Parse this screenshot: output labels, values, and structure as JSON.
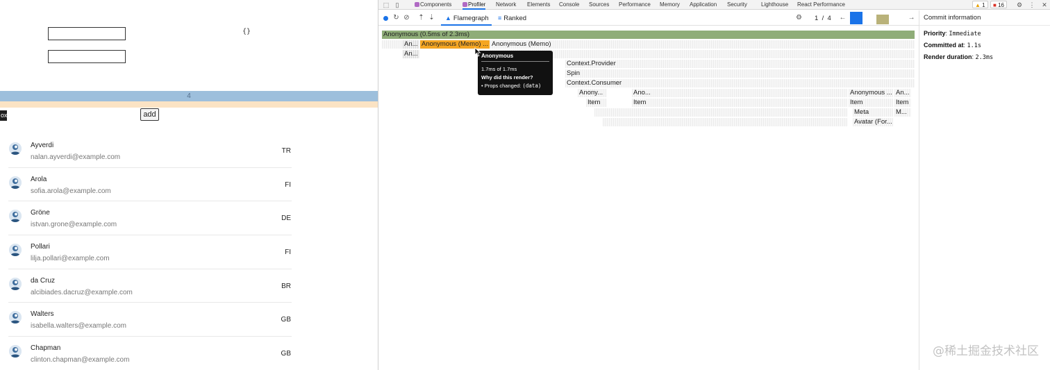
{
  "app": {
    "braces": "{}",
    "count": "4",
    "black_tag": "ox",
    "add_label": "add",
    "users": [
      {
        "name": "Ayverdi",
        "email": "nalan.ayverdi@example.com",
        "country": "TR"
      },
      {
        "name": "Arola",
        "email": "sofia.arola@example.com",
        "country": "FI"
      },
      {
        "name": "Gröne",
        "email": "istvan.grone@example.com",
        "country": "DE"
      },
      {
        "name": "Pollari",
        "email": "lilja.pollari@example.com",
        "country": "FI"
      },
      {
        "name": "da Cruz",
        "email": "alcibiades.dacruz@example.com",
        "country": "BR"
      },
      {
        "name": "Walters",
        "email": "isabella.walters@example.com",
        "country": "GB"
      },
      {
        "name": "Chapman",
        "email": "clinton.chapman@example.com",
        "country": "GB"
      }
    ]
  },
  "devtools": {
    "tabs": [
      "Components",
      "Profiler",
      "Network",
      "Elements",
      "Console",
      "Sources",
      "Performance",
      "Memory",
      "Application",
      "Security",
      "Lighthouse",
      "React Performance"
    ],
    "active_tab": "Profiler",
    "warnings": "1",
    "errors": "16",
    "profiler": {
      "tab_flamegraph": "Flamegraph",
      "tab_ranked": "Ranked",
      "commit_current": "1",
      "commit_sep": "/",
      "commit_total": "4",
      "commit_bar_colors": [
        "#1a73e8",
        "#b9b27a"
      ]
    },
    "flamegraph": {
      "root": "Anonymous (0.5ms of 2.3ms)",
      "row1": [
        "An...",
        "Anonymous (Memo) ...",
        "Anonymous (Memo)"
      ],
      "row2": [
        "An..."
      ],
      "context_provider": "Context.Provider",
      "spin": "Spin",
      "context_consumer": "Context.Consumer",
      "row6": [
        "Anony...",
        "Ano...",
        "Anonymous ...",
        "An..."
      ],
      "row7": [
        "Item",
        "Item",
        "Item",
        "Item"
      ],
      "meta": "Meta",
      "meta_m": "M...",
      "avatar": "Avatar (For..."
    },
    "tooltip": {
      "title": "Anonymous",
      "timing": "1.7ms of 1.7ms",
      "why": "Why did this render?",
      "props_prefix": "• Props changed:",
      "props_value": "(data)"
    },
    "commit_info": {
      "title": "Commit information",
      "priority_label": "Priority",
      "priority_value": "Immediate",
      "committed_label": "Committed at",
      "committed_value": "1.1s",
      "render_label": "Render duration",
      "render_value": "2.3ms"
    }
  },
  "watermark": "@稀土掘金技术社区",
  "colors": {
    "root_bar": "#8fad78",
    "memo_selected": "#f5a623",
    "count_bar": "#9dbfdc",
    "orange_bar": "#fbe3c4",
    "accent": "#1a73e8"
  }
}
